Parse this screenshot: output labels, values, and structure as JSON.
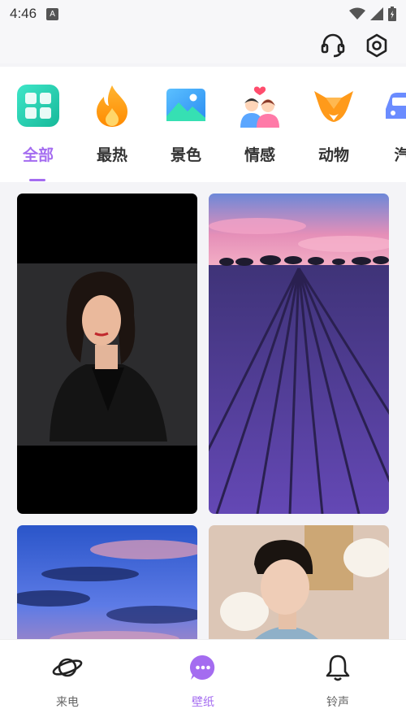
{
  "status_bar": {
    "time": "4:46",
    "badge": "A"
  },
  "categories": [
    {
      "label": "全部",
      "icon": "grid-icon"
    },
    {
      "label": "最热",
      "icon": "flame-icon"
    },
    {
      "label": "景色",
      "icon": "landscape-icon"
    },
    {
      "label": "情感",
      "icon": "couple-icon"
    },
    {
      "label": "动物",
      "icon": "fox-icon"
    },
    {
      "label": "汽",
      "icon": "car-icon"
    }
  ],
  "active_category": "全部",
  "wallpapers": [
    {
      "subject": "woman-portrait"
    },
    {
      "subject": "lavender-field"
    },
    {
      "subject": "sunset-clouds"
    },
    {
      "subject": "man-portrait"
    }
  ],
  "bottom_nav": [
    {
      "label": "来电",
      "icon": "planet-icon"
    },
    {
      "label": "壁纸",
      "icon": "chat-bubble-icon"
    },
    {
      "label": "铃声",
      "icon": "bell-icon"
    }
  ],
  "active_tab": "壁纸",
  "colors": {
    "accent": "#a46cf0",
    "background": "#f4f4f7"
  }
}
